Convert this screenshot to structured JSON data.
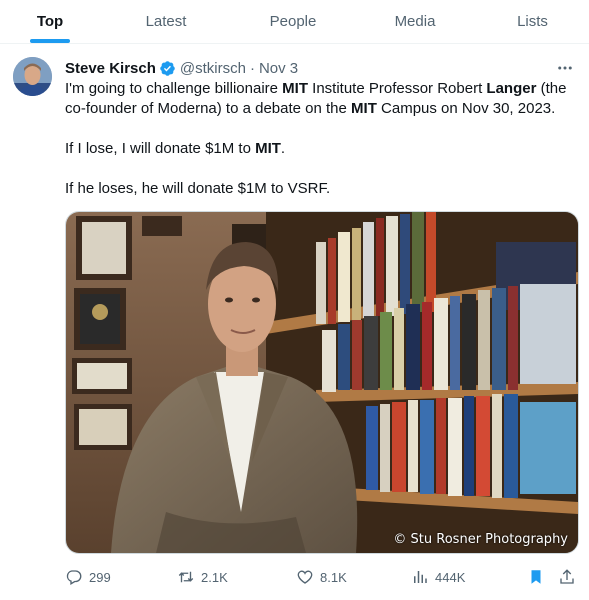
{
  "tabs": [
    {
      "label": "Top",
      "active": true
    },
    {
      "label": "Latest",
      "active": false
    },
    {
      "label": "People",
      "active": false
    },
    {
      "label": "Media",
      "active": false
    },
    {
      "label": "Lists",
      "active": false
    }
  ],
  "tweet": {
    "author_name": "Steve Kirsch",
    "handle": "@stkirsch",
    "separator": "·",
    "date": "Nov 3",
    "more_icon": "more-horizontal-icon",
    "verified_icon": "verified-badge-icon",
    "text": {
      "p1_a": "I'm going to challenge billionaire ",
      "p1_b": "MIT",
      "p1_c": " Institute Professor Robert ",
      "p1_d": "Langer",
      "p1_e": " (the co-founder of Moderna) to a debate on the ",
      "p1_f": "MIT",
      "p1_g": " Campus on Nov 30, 2023.",
      "p2_a": "If I lose, I will donate $1M to ",
      "p2_b": "MIT",
      "p2_c": ".",
      "p3": "If he loses, he will donate $1M to VSRF."
    },
    "media": {
      "credit": "© Stu Rosner Photography"
    },
    "actions": {
      "replies": "299",
      "retweets": "2.1K",
      "likes": "8.1K",
      "views": "444K"
    }
  },
  "colors": {
    "accent": "#1d9bf0",
    "text": "#0f1419",
    "muted": "#536471"
  }
}
